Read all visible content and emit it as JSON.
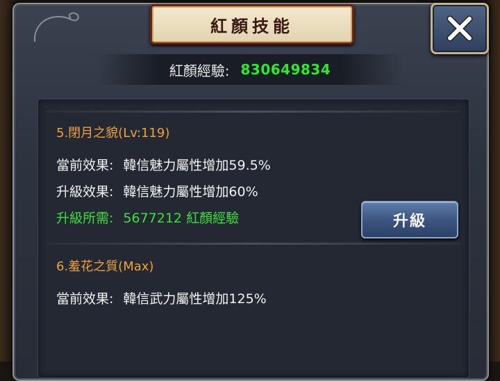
{
  "window": {
    "title": "紅顏技能",
    "close_icon": "close-icon"
  },
  "experience": {
    "label": "紅顏經驗:",
    "value": "830649834"
  },
  "skills": [
    {
      "title": "5.閉月之貌(Lv:119)",
      "current_label": "當前效果:",
      "current_value": "韓信魅力屬性增加59.5%",
      "next_label": "升級效果:",
      "next_value": "韓信魅力屬性增加60%",
      "cost_label": "升級所需:",
      "cost_value": "5677212 紅顏經驗",
      "upgrade_label": "升級"
    },
    {
      "title": "6.羞花之質(Max)",
      "current_label": "當前效果:",
      "current_value": "韓信武力屬性增加125%"
    }
  ],
  "colors": {
    "title_orange": "#f0a23a",
    "value_green": "#2fe82f",
    "text_white": "#f2f2f2"
  }
}
